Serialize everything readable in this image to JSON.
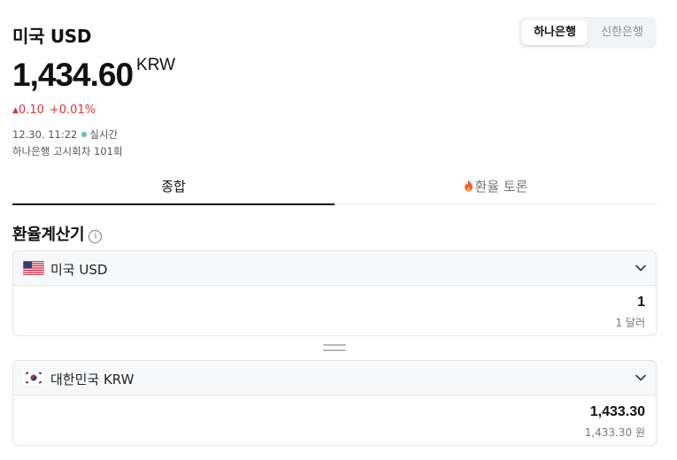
{
  "header": {
    "title": "미국 USD",
    "banks": [
      "하나은행",
      "신한은행"
    ],
    "selected_bank": "하나은행"
  },
  "quote": {
    "price": "1,434.60",
    "unit": "KRW",
    "change_arrow": "▲",
    "change": "0.10",
    "change_percent": "+0.01%",
    "timestamp": "12.30. 11:22",
    "live_label": "실시간",
    "notice": "하나은행 고시회차 101회"
  },
  "tabs": [
    {
      "label": "종합",
      "active": true
    },
    {
      "label": "환율 토론",
      "icon": "fire-icon",
      "active": false
    }
  ],
  "calculator": {
    "title": "환율계산기",
    "info_glyph": "i",
    "from": {
      "currency_label": "미국 USD",
      "flag": "us-flag-icon",
      "amount": "1",
      "amount_text": "1 달러"
    },
    "to": {
      "currency_label": "대한민국 KRW",
      "flag": "kr-flag-icon",
      "amount": "1,433.30",
      "amount_text": "1,433.30 원"
    }
  },
  "colors": {
    "up": "#e0303a",
    "live": "#5cc6a9",
    "active_tab": "#111111"
  }
}
